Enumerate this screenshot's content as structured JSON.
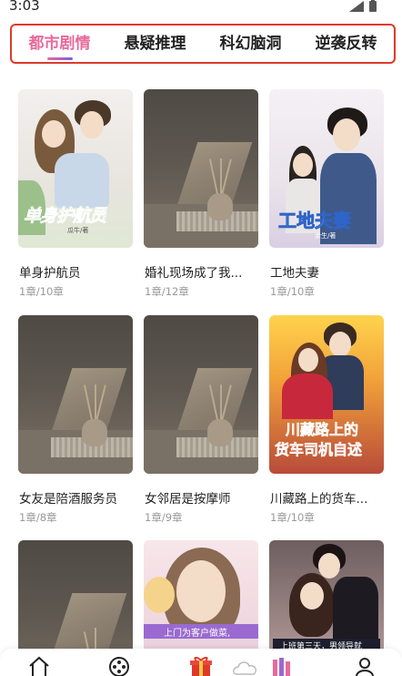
{
  "status": {
    "time": "3:03"
  },
  "tabs": [
    {
      "label": "都市剧情",
      "active": true
    },
    {
      "label": "悬疑推理",
      "active": false
    },
    {
      "label": "科幻脑洞",
      "active": false
    },
    {
      "label": "逆袭反转",
      "active": false
    }
  ],
  "books": [
    {
      "title": "单身护航员",
      "meta": "1章/10章",
      "cover": "romance",
      "cover_title": "单身护航员",
      "cover_author": "瓜牛/著"
    },
    {
      "title": "婚礼现场成了我...",
      "meta": "1章/12章",
      "cover": "placeholder"
    },
    {
      "title": "工地夫妻",
      "meta": "1章/10章",
      "cover": "couple",
      "cover_title": "工地夫妻",
      "cover_author": "余生/著"
    },
    {
      "title": "女友是陪酒服务员",
      "meta": "1章/8章",
      "cover": "placeholder"
    },
    {
      "title": "女邻居是按摩师",
      "meta": "1章/9章",
      "cover": "placeholder"
    },
    {
      "title": "川藏路上的货车...",
      "meta": "1章/10章",
      "cover": "road",
      "cover_title_1": "川藏路上的",
      "cover_title_2": "货车司机自述"
    },
    {
      "title": "",
      "meta": "",
      "cover": "placeholder"
    },
    {
      "title": "",
      "meta": "",
      "cover": "girl",
      "cover_tagline": "上门为客户做菜,"
    },
    {
      "title": "",
      "meta": "",
      "cover": "couple2",
      "cover_tagline": "上班第三天，男领导就"
    }
  ],
  "bottom_nav": [
    {
      "icon": "home-icon"
    },
    {
      "icon": "film-reel-icon"
    },
    {
      "icon": "gift-icon"
    },
    {
      "icon": "cloud-icon"
    },
    {
      "icon": "bookshelf-icon"
    },
    {
      "icon": "profile-icon"
    }
  ],
  "colors": {
    "active_tab": "#e86a9b",
    "highlight_border": "#e0392b"
  }
}
